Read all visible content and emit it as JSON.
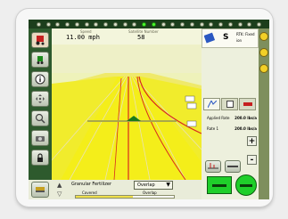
{
  "status": {
    "speed_title": "Speed",
    "speed_value": "11.00 mph",
    "sat_title": "Satellite Number",
    "sat_value": "58"
  },
  "info_panel": {
    "icon_label": "S",
    "header_top": "RTK: Fixed",
    "header_bottom": "ion"
  },
  "rates": {
    "applied_label": "Applied Rate",
    "applied_value": "200.0 lbs/a",
    "rate1_label": "Rate 1",
    "rate1_value": "200.0 lbs/a",
    "plus": "+",
    "minus": "-"
  },
  "bottom": {
    "product": "Granular Fertilizer",
    "dropdown": "Overlap",
    "covered": "Covered",
    "overlap": "Overlap",
    "coverage_fraction": 0.58
  },
  "colors": {
    "accent_green": "#1fcf2a",
    "accent_yellow": "#f2d027",
    "guidance_red": "#d82a1f"
  }
}
